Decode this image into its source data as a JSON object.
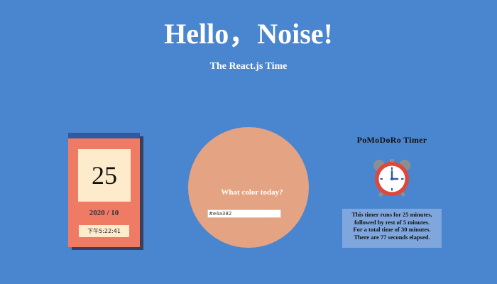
{
  "header": {
    "title": "Hello，Noise!",
    "subtitle": "The React.js Time"
  },
  "calendar": {
    "day": "25",
    "year_month": "2020 / 10",
    "time": "下午5:22:41",
    "colors": {
      "card": "#f07b65",
      "topbar": "#2f5aa0",
      "shadow": "#3a3f5c",
      "panel": "#fdebcc"
    }
  },
  "color_picker": {
    "question": "What color today?",
    "input_value": "#e4a382",
    "circle_color": "#e4a382"
  },
  "pomodoro": {
    "title": "PoMoDoRo Timer",
    "icon": "alarm-clock-icon",
    "info_lines": [
      "This timer runs for 25 minutes,",
      "followed by rest of 5 minutes.",
      "For a total time of 30 minutes.",
      "There are 77 seconds elapsed."
    ]
  },
  "colors": {
    "background": "#4a86cf",
    "text_light": "#ffffff"
  }
}
